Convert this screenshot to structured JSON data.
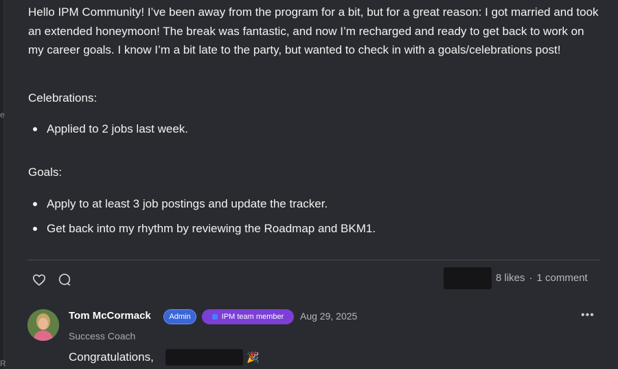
{
  "left_edge": {
    "glyph_top": "e",
    "glyph_bottom": "R"
  },
  "post": {
    "intro": "Hello IPM Community! I’ve been away from the program for a bit, but for a great reason: I got married and took an extended honeymoon! The break was fantastic, and now I’m recharged and ready to get back to work on my career goals. I know I’m a bit late to the party, but wanted to check in with a goals/celebrations post!",
    "celebrations_label": "Celebrations:",
    "celebrations": [
      "Applied to 2 jobs last week."
    ],
    "goals_label": "Goals:",
    "goals": [
      "Apply to at least 3 job postings and update the tracker.",
      "Get back into my rhythm by reviewing the Roadmap and BKM1."
    ]
  },
  "actions": {
    "like_icon": "heart-icon",
    "comment_icon": "comment-bubble-icon",
    "likes_text": "8 likes",
    "separator": "·",
    "comments_text": "1 comment"
  },
  "comment": {
    "author": "Tom McCormack",
    "badge_admin": "Admin",
    "badge_team": "IPM team member",
    "date": "Aug 29, 2025",
    "role": "Success Coach",
    "body": "Congratulations,",
    "emoji": "🎉",
    "more_icon": "more-horizontal-icon"
  },
  "colors": {
    "background": "#2a2b30",
    "admin_badge": "#3b66d8",
    "team_badge": "#7b3fd6",
    "text_muted": "#b7b8bd"
  }
}
